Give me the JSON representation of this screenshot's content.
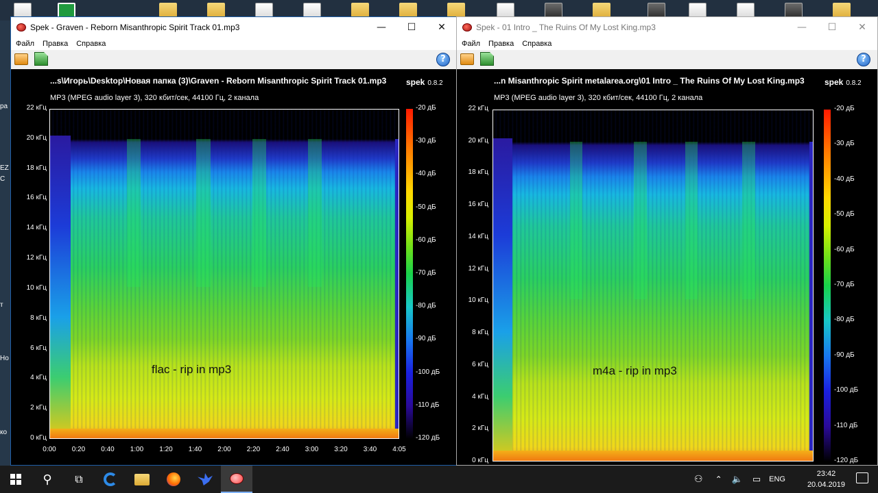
{
  "desktop": {
    "side_labels": [
      "ра",
      "EZ",
      "С",
      "т",
      "Но",
      "ко"
    ]
  },
  "windows": [
    {
      "id": "left",
      "title": "Spek - Graven - Reborn Misanthropic Spirit Track 01.mp3",
      "menu": [
        "Файл",
        "Правка",
        "Справка"
      ],
      "controls": {
        "minimize": "—",
        "maximize": "☐",
        "close": "✕"
      },
      "file_path": "...s\\Игорь\\Desktop\\Новая папка (3)\\Graven - Reborn Misanthropic Spirit Track 01.mp3",
      "brand": "spek",
      "version": "0.8.2",
      "info": "MP3 (MPEG audio layer 3), 320 кбит/сек, 44100 Гц, 2 канала",
      "annotation": "flac - rip in mp3",
      "freq_ticks": [
        "22 кГц",
        "20 кГц",
        "18 кГц",
        "16 кГц",
        "14 кГц",
        "12 кГц",
        "10 кГц",
        "8 кГц",
        "6 кГц",
        "4 кГц",
        "2 кГц",
        "0 кГц"
      ],
      "time_ticks": [
        "0:00",
        "0:20",
        "0:40",
        "1:00",
        "1:20",
        "1:40",
        "2:00",
        "2:20",
        "2:40",
        "3:00",
        "3:20",
        "3:40",
        "4:05"
      ],
      "db_ticks": [
        "-20 дБ",
        "-30 дБ",
        "-40 дБ",
        "-50 дБ",
        "-60 дБ",
        "-70 дБ",
        "-80 дБ",
        "-90 дБ",
        "-100 дБ",
        "-110 дБ",
        "-120 дБ"
      ]
    },
    {
      "id": "right",
      "title": "Spek - 01 Intro _ The Ruins Of My Lost King.mp3",
      "menu": [
        "Файл",
        "Правка",
        "Справка"
      ],
      "controls": {
        "minimize": "—",
        "maximize": "☐",
        "close": "✕"
      },
      "file_path": "...n Misanthropic Spirit metalarea.org\\01 Intro _ The Ruins Of My Lost King.mp3",
      "brand": "spek",
      "version": "0.8.2",
      "info": "MP3 (MPEG audio layer 3), 320 кбит/сек, 44100 Гц, 2 канала",
      "annotation": "m4a - rip in mp3",
      "freq_ticks": [
        "22 кГц",
        "20 кГц",
        "18 кГц",
        "16 кГц",
        "14 кГц",
        "12 кГц",
        "10 кГц",
        "8 кГц",
        "6 кГц",
        "4 кГц",
        "2 кГц",
        "0 кГц"
      ],
      "db_ticks": [
        "-20 дБ",
        "-30 дБ",
        "-40 дБ",
        "-50 дБ",
        "-60 дБ",
        "-70 дБ",
        "-80 дБ",
        "-90 дБ",
        "-100 дБ",
        "-110 дБ",
        "-120 дБ"
      ]
    }
  ],
  "taskbar": {
    "apps": [
      "start-icon",
      "search-icon",
      "task-view-icon",
      "edge-icon",
      "file-explorer-icon",
      "firefox-icon",
      "bird-app-icon",
      "spek-icon"
    ],
    "language": "ENG",
    "time": "23:42",
    "date": "20.04.2019"
  }
}
